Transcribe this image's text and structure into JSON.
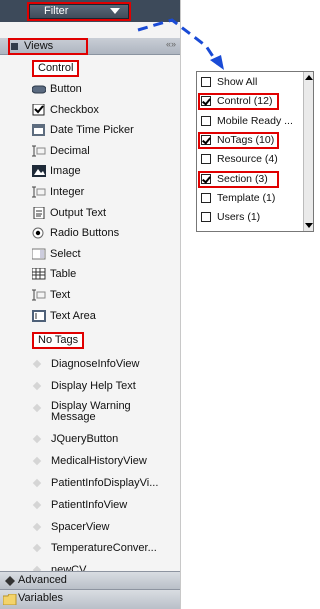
{
  "filter": {
    "label": "Filter"
  },
  "views": {
    "header": "Views",
    "collapse_glyph": "«»",
    "control_group": "Control",
    "controls": [
      {
        "label": "Button",
        "icon": "button-icon"
      },
      {
        "label": "Checkbox",
        "icon": "checkbox-icon"
      },
      {
        "label": "Date Time Picker",
        "icon": "calendar-icon"
      },
      {
        "label": "Decimal",
        "icon": "text-input-icon"
      },
      {
        "label": "Image",
        "icon": "image-icon"
      },
      {
        "label": "Integer",
        "icon": "text-input-icon"
      },
      {
        "label": "Output Text",
        "icon": "document-icon"
      },
      {
        "label": "Radio Buttons",
        "icon": "radio-icon"
      },
      {
        "label": "Select",
        "icon": "select-icon"
      },
      {
        "label": "Table",
        "icon": "table-icon"
      },
      {
        "label": "Text",
        "icon": "text-input-icon"
      },
      {
        "label": "Text Area",
        "icon": "textarea-icon"
      }
    ],
    "notags_group": "No Tags",
    "notags": [
      {
        "label": "DiagnoseInfoView"
      },
      {
        "label": "Display Help Text"
      },
      {
        "label": "Display Warning Message"
      },
      {
        "label": "JQueryButton"
      },
      {
        "label": "MedicalHistoryView"
      },
      {
        "label": "PatientInfoDisplayVi..."
      },
      {
        "label": "PatientInfoView"
      },
      {
        "label": "SpacerView"
      },
      {
        "label": "TemperatureConver..."
      },
      {
        "label": "newCV"
      }
    ]
  },
  "advanced": {
    "label": "Advanced"
  },
  "variables": {
    "label": "Variables"
  },
  "dropdown": {
    "options": [
      {
        "label": "Show All",
        "checked": false
      },
      {
        "label": "Control (12)",
        "checked": true
      },
      {
        "label": "Mobile Ready ...",
        "checked": false
      },
      {
        "label": "NoTags (10)",
        "checked": true
      },
      {
        "label": "Resource (4)",
        "checked": false
      },
      {
        "label": "Section (3)",
        "checked": true
      },
      {
        "label": "Template (1)",
        "checked": false
      },
      {
        "label": "Users (1)",
        "checked": false
      }
    ]
  },
  "colors": {
    "annotation_red": "#e00000",
    "annotation_blue": "#1a4bd6",
    "toolbar": "#3d4a5a"
  }
}
